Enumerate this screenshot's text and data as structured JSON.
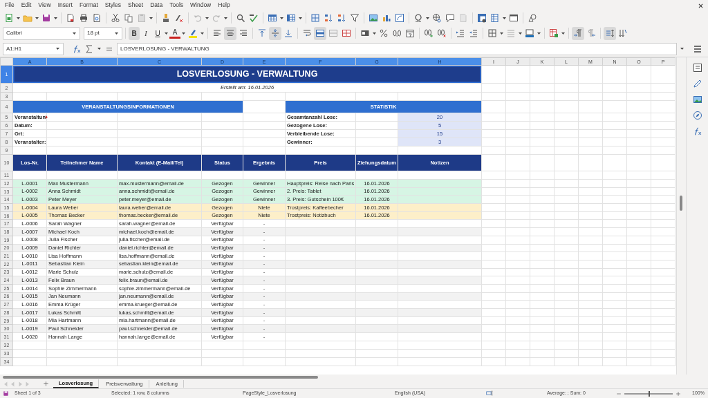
{
  "menu": [
    "File",
    "Edit",
    "View",
    "Insert",
    "Format",
    "Styles",
    "Sheet",
    "Data",
    "Tools",
    "Window",
    "Help"
  ],
  "format_bar": {
    "font_name": "Calibri",
    "font_size": "18 pt",
    "toggles": [
      {
        "kind": "bold",
        "label": "B",
        "selected": true
      },
      {
        "kind": "italic",
        "label": "I",
        "selected": false
      },
      {
        "kind": "underline",
        "label": "U",
        "selected": false
      }
    ],
    "font_color_label": "A",
    "align_buttons": [
      {
        "kind": "left",
        "selected": false
      },
      {
        "kind": "center",
        "selected": true
      },
      {
        "kind": "right",
        "selected": false
      }
    ],
    "valign_buttons": [
      {
        "kind": "top",
        "selected": false
      },
      {
        "kind": "center",
        "selected": true
      },
      {
        "kind": "bottom",
        "selected": false
      }
    ],
    "merged": true
  },
  "formula_bar": {
    "name_box": "A1:H1",
    "content": "LOSVERLOSUNG - VERWALTUNG"
  },
  "columns": [
    {
      "label": "A",
      "selected": true
    },
    {
      "label": "B",
      "selected": true
    },
    {
      "label": "C",
      "selected": true
    },
    {
      "label": "D",
      "selected": true
    },
    {
      "label": "E",
      "selected": true
    },
    {
      "label": "F",
      "selected": true
    },
    {
      "label": "G",
      "selected": true
    },
    {
      "label": "H",
      "selected": true
    },
    {
      "label": "I",
      "selected": false
    },
    {
      "label": "J",
      "selected": false
    },
    {
      "label": "K",
      "selected": false
    },
    {
      "label": "L",
      "selected": false
    },
    {
      "label": "M",
      "selected": false
    },
    {
      "label": "N",
      "selected": false
    },
    {
      "label": "O",
      "selected": false
    },
    {
      "label": "P",
      "selected": false
    }
  ],
  "rows": [
    {
      "number": "1",
      "kind": "title",
      "selected": true,
      "text": "LOSVERLOSUNG - VERWALTUNG"
    },
    {
      "number": "2",
      "kind": "subtitle",
      "selected": false,
      "text": "Erstellt am: 16.01.2026"
    },
    {
      "number": "3",
      "kind": "blank",
      "selected": false
    },
    {
      "number": "4",
      "kind": "section",
      "selected": false,
      "left": "VERANSTALTUNGSINFORMATIONEN",
      "right": "STATISTIK"
    },
    {
      "number": "5",
      "kind": "info",
      "selected": false,
      "label": "Veranstaltun",
      "clipped": true,
      "stat_label": "Gesamtanzahl Lose:",
      "stat_value": "20"
    },
    {
      "number": "6",
      "kind": "info",
      "selected": false,
      "label": "Datum:",
      "clipped": false,
      "stat_label": "Gezogene Lose:",
      "stat_value": "5"
    },
    {
      "number": "7",
      "kind": "info",
      "selected": false,
      "label": "Ort:",
      "clipped": false,
      "stat_label": "Verbleibende Lose:",
      "stat_value": "15"
    },
    {
      "number": "8",
      "kind": "info",
      "selected": false,
      "label": "Veranstalter:",
      "clipped": false,
      "stat_label": "Gewinner:",
      "stat_value": "3"
    },
    {
      "number": "9",
      "kind": "blank",
      "selected": false
    },
    {
      "number": "10",
      "kind": "header",
      "selected": false,
      "cells": [
        "Los-Nr.",
        "Teilnehmer Name",
        "Kontakt (E-Mail/Tel)",
        "Status",
        "Ergebnis",
        "Preis",
        "Ziehungsdatum",
        "Notizen"
      ]
    },
    {
      "number": "11",
      "kind": "blank",
      "selected": false
    },
    {
      "number": "12",
      "kind": "entry",
      "selected": false,
      "color": "#d6f5e4",
      "cells": [
        "L-0001",
        "Max Mustermann",
        "max.mustermann@email.de",
        "Gezogen",
        "Gewinner",
        "Hauptpreis: Reise nach Paris",
        "16.01.2026"
      ]
    },
    {
      "number": "13",
      "kind": "entry",
      "selected": false,
      "color": "#d6f5e4",
      "cells": [
        "L-0002",
        "Anna Schmidt",
        "anna.schmidt@email.de",
        "Gezogen",
        "Gewinner",
        "2. Preis: Tablet",
        "16.01.2026"
      ]
    },
    {
      "number": "14",
      "kind": "entry",
      "selected": false,
      "color": "#d6f5e4",
      "cells": [
        "L-0003",
        "Peter Meyer",
        "peter.meyer@email.de",
        "Gezogen",
        "Gewinner",
        "3. Preis: Gutschein 100€",
        "16.01.2026"
      ]
    },
    {
      "number": "15",
      "kind": "entry",
      "selected": false,
      "color": "#fdefc9",
      "cells": [
        "L-0004",
        "Laura Weber",
        "laura.weber@email.de",
        "Gezogen",
        "Niete",
        "Trostpreis: Kaffeebecher",
        "16.01.2026"
      ]
    },
    {
      "number": "16",
      "kind": "entry",
      "selected": false,
      "color": "#fdefc9",
      "cells": [
        "L-0005",
        "Thomas Becker",
        "thomas.becker@email.de",
        "Gezogen",
        "Niete",
        "Trostpreis: Notizbuch",
        "16.01.2026"
      ]
    },
    {
      "number": "17",
      "kind": "entry",
      "selected": false,
      "color": "#ffffff",
      "cells": [
        "L-0006",
        "Sarah Wagner",
        "sarah.wagner@email.de",
        "Verfügbar",
        "-"
      ]
    },
    {
      "number": "18",
      "kind": "entry",
      "selected": false,
      "color": "#f2f2f2",
      "cells": [
        "L-0007",
        "Michael Koch",
        "michael.koch@email.de",
        "Verfügbar",
        "-"
      ]
    },
    {
      "number": "19",
      "kind": "entry",
      "selected": false,
      "color": "#ffffff",
      "cells": [
        "L-0008",
        "Julia Fischer",
        "julia.fischer@email.de",
        "Verfügbar",
        "-"
      ]
    },
    {
      "number": "20",
      "kind": "entry",
      "selected": false,
      "color": "#f2f2f2",
      "cells": [
        "L-0009",
        "Daniel Richter",
        "daniel.richter@email.de",
        "Verfügbar",
        "-"
      ]
    },
    {
      "number": "21",
      "kind": "entry",
      "selected": false,
      "color": "#ffffff",
      "cells": [
        "L-0010",
        "Lisa Hoffmann",
        "lisa.hoffmann@email.de",
        "Verfügbar",
        "-"
      ]
    },
    {
      "number": "22",
      "kind": "entry",
      "selected": false,
      "color": "#f2f2f2",
      "cells": [
        "L-0011",
        "Sebastian Klein",
        "sebastian.klein@email.de",
        "Verfügbar",
        "-"
      ]
    },
    {
      "number": "23",
      "kind": "entry",
      "selected": false,
      "color": "#ffffff",
      "cells": [
        "L-0012",
        "Marie Schulz",
        "marie.schulz@email.de",
        "Verfügbar",
        "-"
      ]
    },
    {
      "number": "24",
      "kind": "entry",
      "selected": false,
      "color": "#f2f2f2",
      "cells": [
        "L-0013",
        "Felix Braun",
        "felix.braun@email.de",
        "Verfügbar",
        "-"
      ]
    },
    {
      "number": "25",
      "kind": "entry",
      "selected": false,
      "color": "#ffffff",
      "cells": [
        "L-0014",
        "Sophie Zimmermann",
        "sophie.zimmermann@email.de",
        "Verfügbar",
        "-"
      ]
    },
    {
      "number": "26",
      "kind": "entry",
      "selected": false,
      "color": "#f2f2f2",
      "cells": [
        "L-0015",
        "Jan Neumann",
        "jan.neumann@email.de",
        "Verfügbar",
        "-"
      ]
    },
    {
      "number": "27",
      "kind": "entry",
      "selected": false,
      "color": "#ffffff",
      "cells": [
        "L-0016",
        "Emma Krüger",
        "emma.krueger@email.de",
        "Verfügbar",
        "-"
      ]
    },
    {
      "number": "28",
      "kind": "entry",
      "selected": false,
      "color": "#f2f2f2",
      "cells": [
        "L-0017",
        "Lukas Schmitt",
        "lukas.schmitt@email.de",
        "Verfügbar",
        "-"
      ]
    },
    {
      "number": "29",
      "kind": "entry",
      "selected": false,
      "color": "#ffffff",
      "cells": [
        "L-0018",
        "Mia Hartmann",
        "mia.hartmann@email.de",
        "Verfügbar",
        "-"
      ]
    },
    {
      "number": "30",
      "kind": "entry",
      "selected": false,
      "color": "#f2f2f2",
      "cells": [
        "L-0019",
        "Paul Schneider",
        "paul.schneider@email.de",
        "Verfügbar",
        "-"
      ]
    },
    {
      "number": "31",
      "kind": "entry",
      "selected": false,
      "color": "#ffffff",
      "cells": [
        "L-0020",
        "Hannah Lange",
        "hannah.lange@email.de",
        "Verfügbar",
        "-"
      ]
    },
    {
      "number": "32",
      "kind": "blank",
      "selected": false
    },
    {
      "number": "33",
      "kind": "blank",
      "selected": false
    },
    {
      "number": "34",
      "kind": "blank",
      "selected": false
    }
  ],
  "sheet_tabs": [
    {
      "label": "Losverlosung",
      "selected": true
    },
    {
      "label": "Preisverwaltung",
      "selected": false
    },
    {
      "label": "Anleitung",
      "selected": false
    }
  ],
  "status_bar": {
    "sheet": "Sheet 1 of 3",
    "selection": "Selected: 1 row, 8 columns",
    "page_style": "PageStyle_Losverlosung",
    "language": "English (USA)",
    "summary": "Average: ; Sum: 0",
    "zoom_slider": {
      "level": 0.5
    },
    "zoom": "100%"
  }
}
